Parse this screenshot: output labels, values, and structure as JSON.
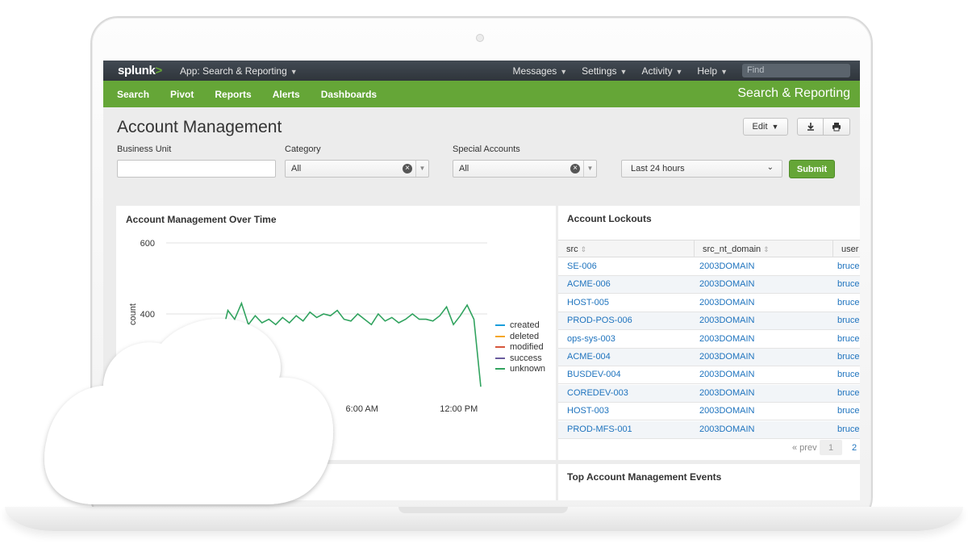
{
  "topbar": {
    "logo": "splunk",
    "logo_suffix": ">",
    "app_menu": "App: Search & Reporting",
    "menu": [
      {
        "label": "Messages"
      },
      {
        "label": "Settings"
      },
      {
        "label": "Activity"
      },
      {
        "label": "Help"
      }
    ],
    "find_placeholder": "Find"
  },
  "appbar": {
    "nav": [
      "Search",
      "Pivot",
      "Reports",
      "Alerts",
      "Dashboards"
    ],
    "app_title": "Search & Reporting"
  },
  "dashboard": {
    "title": "Account Management",
    "edit_label": "Edit",
    "filters": {
      "business_unit_label": "Business Unit",
      "business_unit_value": "",
      "category_label": "Category",
      "category_value": "All",
      "special_accounts_label": "Special Accounts",
      "special_accounts_value": "All",
      "time_range": "Last 24 hours",
      "submit_label": "Submit"
    }
  },
  "chart_panel": {
    "title": "Account Management Over Time"
  },
  "chart_data": {
    "type": "line",
    "title": "Account Management Over Time",
    "ylabel": "count",
    "ylim": [
      0,
      600
    ],
    "y_ticks": [
      600,
      400
    ],
    "x_ticks": [
      "6:00 AM",
      "12:00 PM"
    ],
    "legend_position": "right",
    "series": [
      {
        "name": "created",
        "color": "#1a9edb",
        "values": [
          20,
          18,
          20,
          17,
          20,
          18,
          20,
          17,
          20,
          18,
          20,
          17,
          20,
          18,
          20,
          17,
          20,
          18,
          20,
          17,
          20,
          18,
          20,
          17,
          20,
          18,
          20,
          17,
          20,
          18,
          20,
          17,
          20,
          18,
          20,
          17,
          20,
          18,
          20
        ]
      },
      {
        "name": "deleted",
        "color": "#f5a623",
        "values": [
          30,
          25,
          30,
          25,
          30,
          25,
          30,
          25,
          30,
          25,
          30,
          25,
          30,
          25,
          30,
          25,
          30,
          25,
          30,
          25,
          30,
          25,
          30,
          25,
          30,
          25,
          30,
          25,
          30,
          25,
          30,
          25,
          30,
          25,
          30,
          25,
          30,
          25,
          30
        ]
      },
      {
        "name": "modified",
        "color": "#d6563c",
        "values": [
          20,
          80,
          20,
          80,
          20,
          80,
          20,
          80,
          20,
          80,
          20,
          80,
          20,
          80,
          20,
          80,
          20,
          80,
          20,
          80,
          20,
          80,
          20,
          80,
          20,
          80,
          20,
          80,
          20,
          80,
          20,
          80,
          20,
          80,
          20,
          80,
          20,
          80,
          20
        ]
      },
      {
        "name": "success",
        "color": "#6a5c9e",
        "values": [
          10,
          40,
          10,
          40,
          10,
          40,
          10,
          40,
          10,
          40,
          10,
          40,
          10,
          40,
          10,
          40,
          10,
          40,
          10,
          40,
          10,
          40,
          10,
          40,
          10,
          40,
          10,
          40,
          10,
          40,
          10,
          40,
          10,
          40,
          10,
          40,
          10,
          40,
          10
        ]
      },
      {
        "name": "unknown",
        "color": "#31a35f",
        "values": [
          330,
          410,
          385,
          430,
          370,
          395,
          375,
          385,
          370,
          390,
          375,
          395,
          380,
          405,
          390,
          400,
          395,
          410,
          385,
          380,
          400,
          385,
          370,
          400,
          380,
          390,
          375,
          385,
          400,
          385,
          385,
          380,
          395,
          420,
          370,
          395,
          425,
          385,
          195
        ]
      }
    ]
  },
  "lockouts_panel": {
    "title": "Account Lockouts",
    "columns": [
      "src",
      "src_nt_domain",
      "user"
    ],
    "rows": [
      {
        "src": "SE-006",
        "domain": "2003DOMAIN",
        "user": "bruce"
      },
      {
        "src": "ACME-006",
        "domain": "2003DOMAIN",
        "user": "bruce"
      },
      {
        "src": "HOST-005",
        "domain": "2003DOMAIN",
        "user": "bruce"
      },
      {
        "src": "PROD-POS-006",
        "domain": "2003DOMAIN",
        "user": "bruce"
      },
      {
        "src": "ops-sys-003",
        "domain": "2003DOMAIN",
        "user": "bruce"
      },
      {
        "src": "ACME-004",
        "domain": "2003DOMAIN",
        "user": "bruce"
      },
      {
        "src": "BUSDEV-004",
        "domain": "2003DOMAIN",
        "user": "bruce"
      },
      {
        "src": "COREDEV-003",
        "domain": "2003DOMAIN",
        "user": "bruce"
      },
      {
        "src": "HOST-003",
        "domain": "2003DOMAIN",
        "user": "bruce"
      },
      {
        "src": "PROD-MFS-001",
        "domain": "2003DOMAIN",
        "user": "bruce"
      }
    ],
    "pager_prev": "« prev",
    "pager_pages": [
      "1",
      "2"
    ]
  },
  "events_panel": {
    "title": "Top Account Management Events"
  }
}
